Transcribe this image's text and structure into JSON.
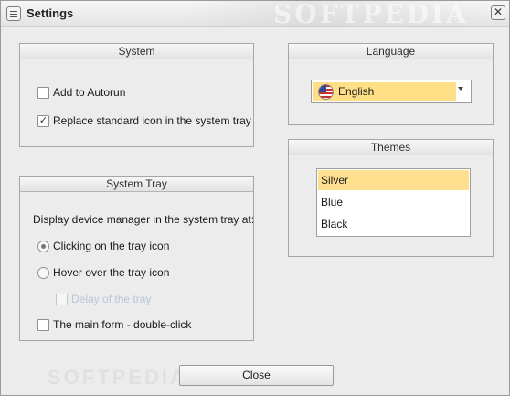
{
  "window": {
    "title": "Settings",
    "close_glyph": "✕"
  },
  "watermarks": {
    "top": "SOFTPEDIA",
    "middle": "SOFTPEDIA"
  },
  "system": {
    "header": "System",
    "add_autorun": {
      "label": "Add to Autorun",
      "checked": false
    },
    "replace_icon": {
      "label": "Replace standard icon in the system tray",
      "checked": true
    }
  },
  "system_tray": {
    "header": "System Tray",
    "prompt": "Display device manager in the system tray at:",
    "options": [
      {
        "label": "Clicking on the tray icon",
        "selected": true
      },
      {
        "label": "Hover over the tray icon",
        "selected": false
      }
    ],
    "delay": {
      "label": "Delay of the tray",
      "checked": false,
      "enabled": false
    },
    "main_form": {
      "label": "The main form - double-click",
      "checked": false
    }
  },
  "language": {
    "header": "Language",
    "selected": "English",
    "icon": "us-flag-icon"
  },
  "themes": {
    "header": "Themes",
    "items": [
      "Silver",
      "Blue",
      "Black"
    ],
    "selected": "Silver"
  },
  "actions": {
    "close_label": "Close"
  },
  "colors": {
    "accent_highlight": "#ffe08e",
    "window_bg": "#ececec"
  }
}
